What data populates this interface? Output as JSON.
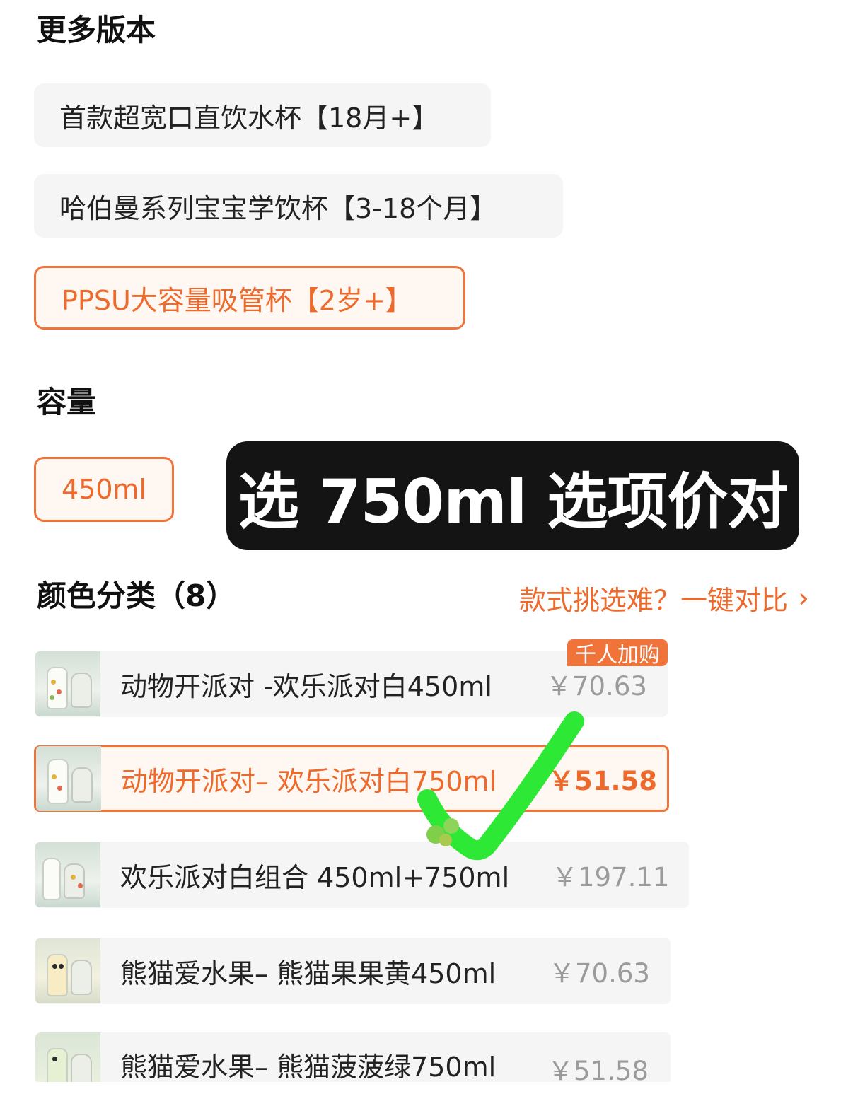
{
  "more_versions": {
    "title": "更多版本",
    "options": [
      {
        "label": "首款超宽口直饮水杯【18月+】",
        "selected": false
      },
      {
        "label": "哈伯曼系列宝宝学饮杯【3-18个月】",
        "selected": false
      },
      {
        "label": "PPSU大容量吸管杯【2岁+】",
        "selected": true
      }
    ]
  },
  "capacity": {
    "title": "容量",
    "options": [
      {
        "label": "450ml",
        "selected": true
      }
    ]
  },
  "overlay_caption": "选 750ml 选项价对",
  "colors": {
    "title": "颜色分类（8）",
    "compare_link": "款式挑选难？一键对比",
    "compare_chevron": "›",
    "badge": "千人加购",
    "items": [
      {
        "name": "动物开派对 -欢乐派对白450ml",
        "price": "￥70.63",
        "selected": false
      },
      {
        "name": "动物开派对– 欢乐派对白750ml",
        "price": "￥51.58",
        "selected": true
      },
      {
        "name": "欢乐派对白组合 450ml+750ml",
        "price": "￥197.11",
        "selected": false
      },
      {
        "name": "熊猫爱水果– 熊猫果果黄450ml",
        "price": "￥70.63",
        "selected": false
      },
      {
        "name": "熊猫爱水果– 熊猫菠菠绿750ml",
        "price": "￥51.58",
        "selected": false
      }
    ]
  },
  "colors_meta": {
    "accent": "#ee6a2c",
    "check_mark": "#2ee836",
    "caption_bg": "#141414"
  }
}
